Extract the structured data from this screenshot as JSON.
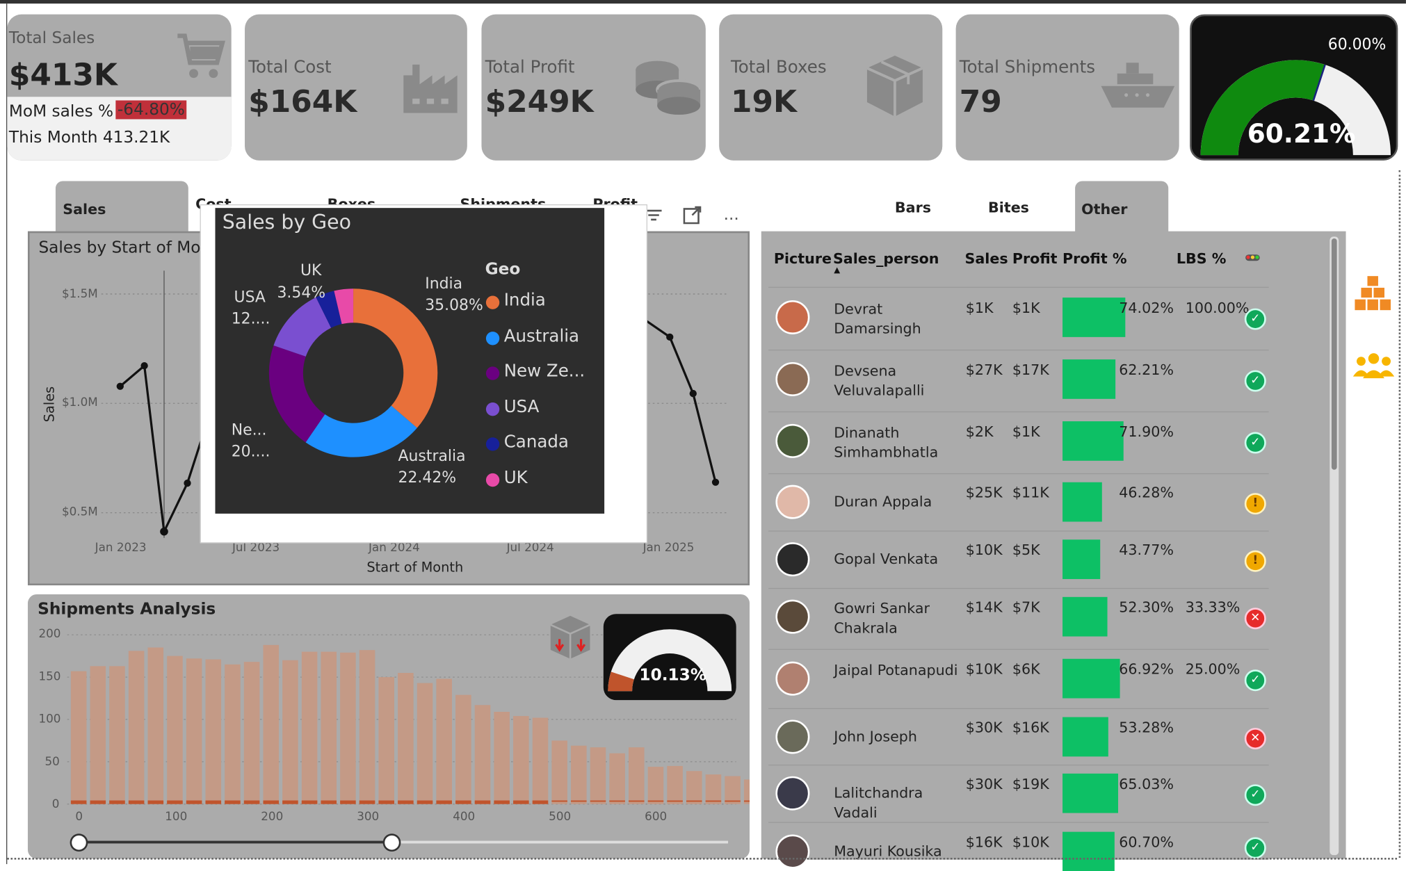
{
  "kpis": {
    "sales": {
      "label": "Total Sales",
      "value": "$413K",
      "mom_label": "MoM sales %",
      "mom_value": "-64.80%",
      "this_month": "This Month 413.21K"
    },
    "cost": {
      "label": "Total Cost",
      "value": "$164K"
    },
    "profit": {
      "label": "Total Profit",
      "value": "$249K"
    },
    "boxes": {
      "label": "Total Boxes",
      "value": "19K"
    },
    "shipments": {
      "label": "Total Shipments",
      "value": "79"
    },
    "gauge": {
      "target_label": "60.00%",
      "value_label": "60.21%",
      "value": 60.21,
      "target": 60.0
    }
  },
  "left_tabs": [
    "Sales",
    "Cost",
    "Boxes",
    "Shipments",
    "Profit"
  ],
  "right_tabs": [
    "Bars",
    "Bites",
    "Other"
  ],
  "line_chart": {
    "title": "Sales by Start of Mo",
    "ylabel": "Sales",
    "xlabel": "Start of Month",
    "yticks": [
      "$1.5M",
      "$1.0M",
      "$0.5M"
    ],
    "xticks": [
      "Jan 2023",
      "Jul 2023",
      "Jan 2024",
      "Jul 2024",
      "Jan 2025"
    ]
  },
  "geo_popup": {
    "title": "Sales by Geo",
    "legend_title": "Geo",
    "legend": [
      "India",
      "Australia",
      "New Ze...",
      "USA",
      "Canada",
      "UK"
    ],
    "slice_labels": {
      "india_name": "India",
      "india_pct": "35.08%",
      "australia_name": "Australia",
      "australia_pct": "22.42%",
      "nz_name": "Ne...",
      "nz_pct": "20....",
      "usa_name": "USA",
      "usa_pct": "12....",
      "uk_name": "UK",
      "uk_pct": "3.54%"
    },
    "colors": {
      "India": "#e8703a",
      "Australia": "#1e90ff",
      "New Ze...": "#6a0080",
      "USA": "#7a4fd0",
      "Canada": "#17209a",
      "UK": "#e84aa8"
    }
  },
  "shipments": {
    "title": "Shipments Analysis",
    "gauge_label": "10.13%",
    "yticks": [
      "200",
      "150",
      "100",
      "50",
      "0"
    ],
    "xticks": [
      "0",
      "100",
      "200",
      "300",
      "400",
      "500",
      "600"
    ]
  },
  "chart_data": [
    {
      "type": "pie",
      "title": "Sales by Geo",
      "categories": [
        "India",
        "Australia",
        "New Zealand",
        "USA",
        "Canada",
        "UK"
      ],
      "values": [
        35.08,
        22.42,
        20.0,
        12.0,
        3.5,
        3.54
      ]
    },
    {
      "type": "bar",
      "title": "Shipments Analysis",
      "values": [
        157,
        163,
        163,
        181,
        185,
        175,
        172,
        171,
        165,
        168,
        188,
        170,
        180,
        180,
        179,
        182,
        150,
        155,
        143,
        148,
        129,
        117,
        109,
        104,
        102,
        75,
        69,
        67,
        60,
        67,
        44,
        45,
        39,
        35,
        33,
        29,
        20
      ],
      "xlim": [
        0,
        690
      ],
      "ylim": [
        0,
        200
      ]
    }
  ],
  "table": {
    "headers": {
      "picture": "Picture",
      "person": "Sales_person",
      "sales": "Sales",
      "profit": "Profit",
      "profit_pct": "Profit %",
      "lbs_pct": "LBS %"
    },
    "rows": [
      {
        "name": "Devrat Damarsingh",
        "sales": "$1K",
        "profit": "$1K",
        "pct": "74.02%",
        "pctv": 74.02,
        "lbs": "100.00%",
        "status": "ok"
      },
      {
        "name": "Devsena Veluvalapalli",
        "sales": "$27K",
        "profit": "$17K",
        "pct": "62.21%",
        "pctv": 62.21,
        "lbs": "",
        "status": "ok"
      },
      {
        "name": "Dinanath Simhambhatla",
        "sales": "$2K",
        "profit": "$1K",
        "pct": "71.90%",
        "pctv": 71.9,
        "lbs": "",
        "status": "ok"
      },
      {
        "name": "Duran Appala",
        "sales": "$25K",
        "profit": "$11K",
        "pct": "46.28%",
        "pctv": 46.28,
        "lbs": "",
        "status": "warn"
      },
      {
        "name": "Gopal Venkata",
        "sales": "$10K",
        "profit": "$5K",
        "pct": "43.77%",
        "pctv": 43.77,
        "lbs": "",
        "status": "warn"
      },
      {
        "name": "Gowri Sankar Chakrala",
        "sales": "$14K",
        "profit": "$7K",
        "pct": "52.30%",
        "pctv": 52.3,
        "lbs": "33.33%",
        "status": "bad"
      },
      {
        "name": "Jaipal Potanapudi",
        "sales": "$10K",
        "profit": "$6K",
        "pct": "66.92%",
        "pctv": 66.92,
        "lbs": "25.00%",
        "status": "ok"
      },
      {
        "name": "John Joseph",
        "sales": "$30K",
        "profit": "$16K",
        "pct": "53.28%",
        "pctv": 53.28,
        "lbs": "",
        "status": "bad"
      },
      {
        "name": "Lalitchandra Vadali",
        "sales": "$30K",
        "profit": "$19K",
        "pct": "65.03%",
        "pctv": 65.03,
        "lbs": "",
        "status": "ok"
      },
      {
        "name": "Mayuri Kousika",
        "sales": "$16K",
        "profit": "$10K",
        "pct": "60.70%",
        "pctv": 60.7,
        "lbs": "",
        "status": "ok"
      }
    ]
  }
}
